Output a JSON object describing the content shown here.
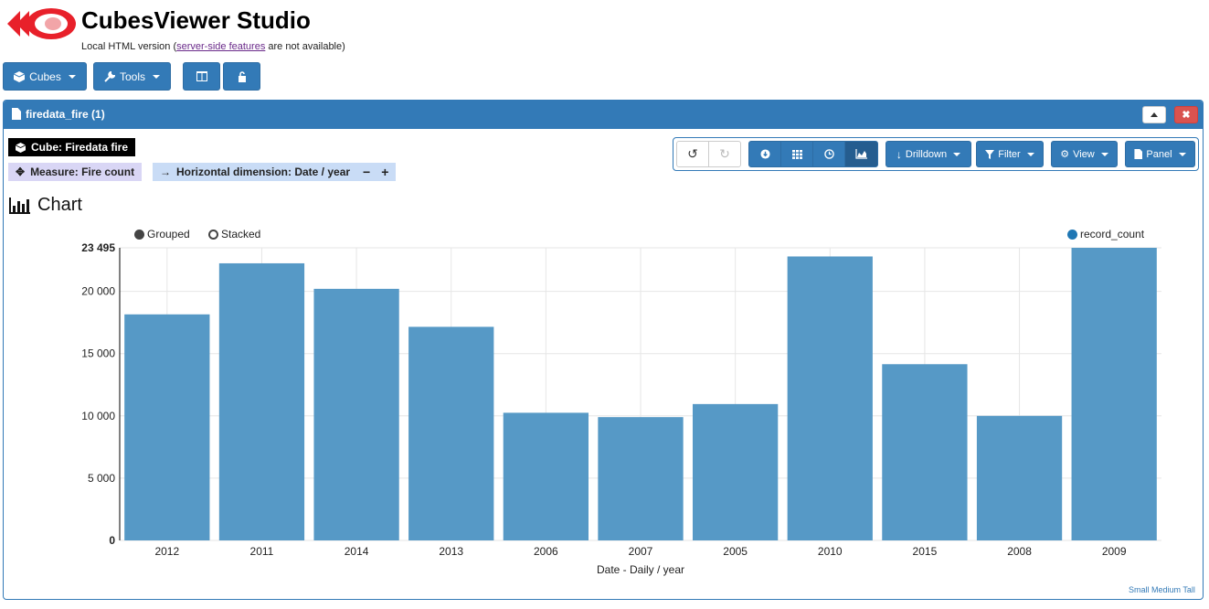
{
  "app": {
    "title": "CubesViewer Studio",
    "subtitle_pre": "Local HTML version (",
    "subtitle_link": "server-side features",
    "subtitle_post": " are not available)"
  },
  "topbar": {
    "cubes_label": "Cubes",
    "tools_label": "Tools"
  },
  "panel": {
    "title": "firedata_fire (1)",
    "cube_tag": "Cube: Firedata fire",
    "measure_tag": "Measure: Fire count",
    "dimension_tag": "Horizontal dimension: Date / year",
    "minus": "−",
    "plus": "+"
  },
  "toolbar": {
    "drilldown": "Drilldown",
    "filter": "Filter",
    "view": "View",
    "panel": "Panel"
  },
  "chart_heading": "Chart",
  "legend": {
    "grouped": "Grouped",
    "stacked": "Stacked",
    "series": "record_count"
  },
  "footer_links": "Small Medium Tall",
  "colors": {
    "accent": "#337ab7",
    "bar": "#5699c6",
    "danger": "#d9534f",
    "tag_blue": "#c9dcf6",
    "tag_purple": "#d9d6f5"
  },
  "chart_data": {
    "type": "bar",
    "categories": [
      "2012",
      "2011",
      "2014",
      "2013",
      "2006",
      "2007",
      "2005",
      "2010",
      "2015",
      "2008",
      "2009"
    ],
    "series": [
      {
        "name": "record_count",
        "values": [
          18150,
          22250,
          20200,
          17150,
          10250,
          9900,
          10950,
          22800,
          14150,
          10000,
          23495
        ]
      }
    ],
    "ylim": [
      0,
      23495
    ],
    "yticks": [
      0,
      5000,
      10000,
      15000,
      20000,
      23495
    ],
    "ytick_labels": [
      "0",
      "5 000",
      "10 000",
      "15 000",
      "20 000",
      "23 495"
    ],
    "xlabel": "Date - Daily / year",
    "ylabel": "",
    "grid": true,
    "legend_position": "top-right"
  }
}
